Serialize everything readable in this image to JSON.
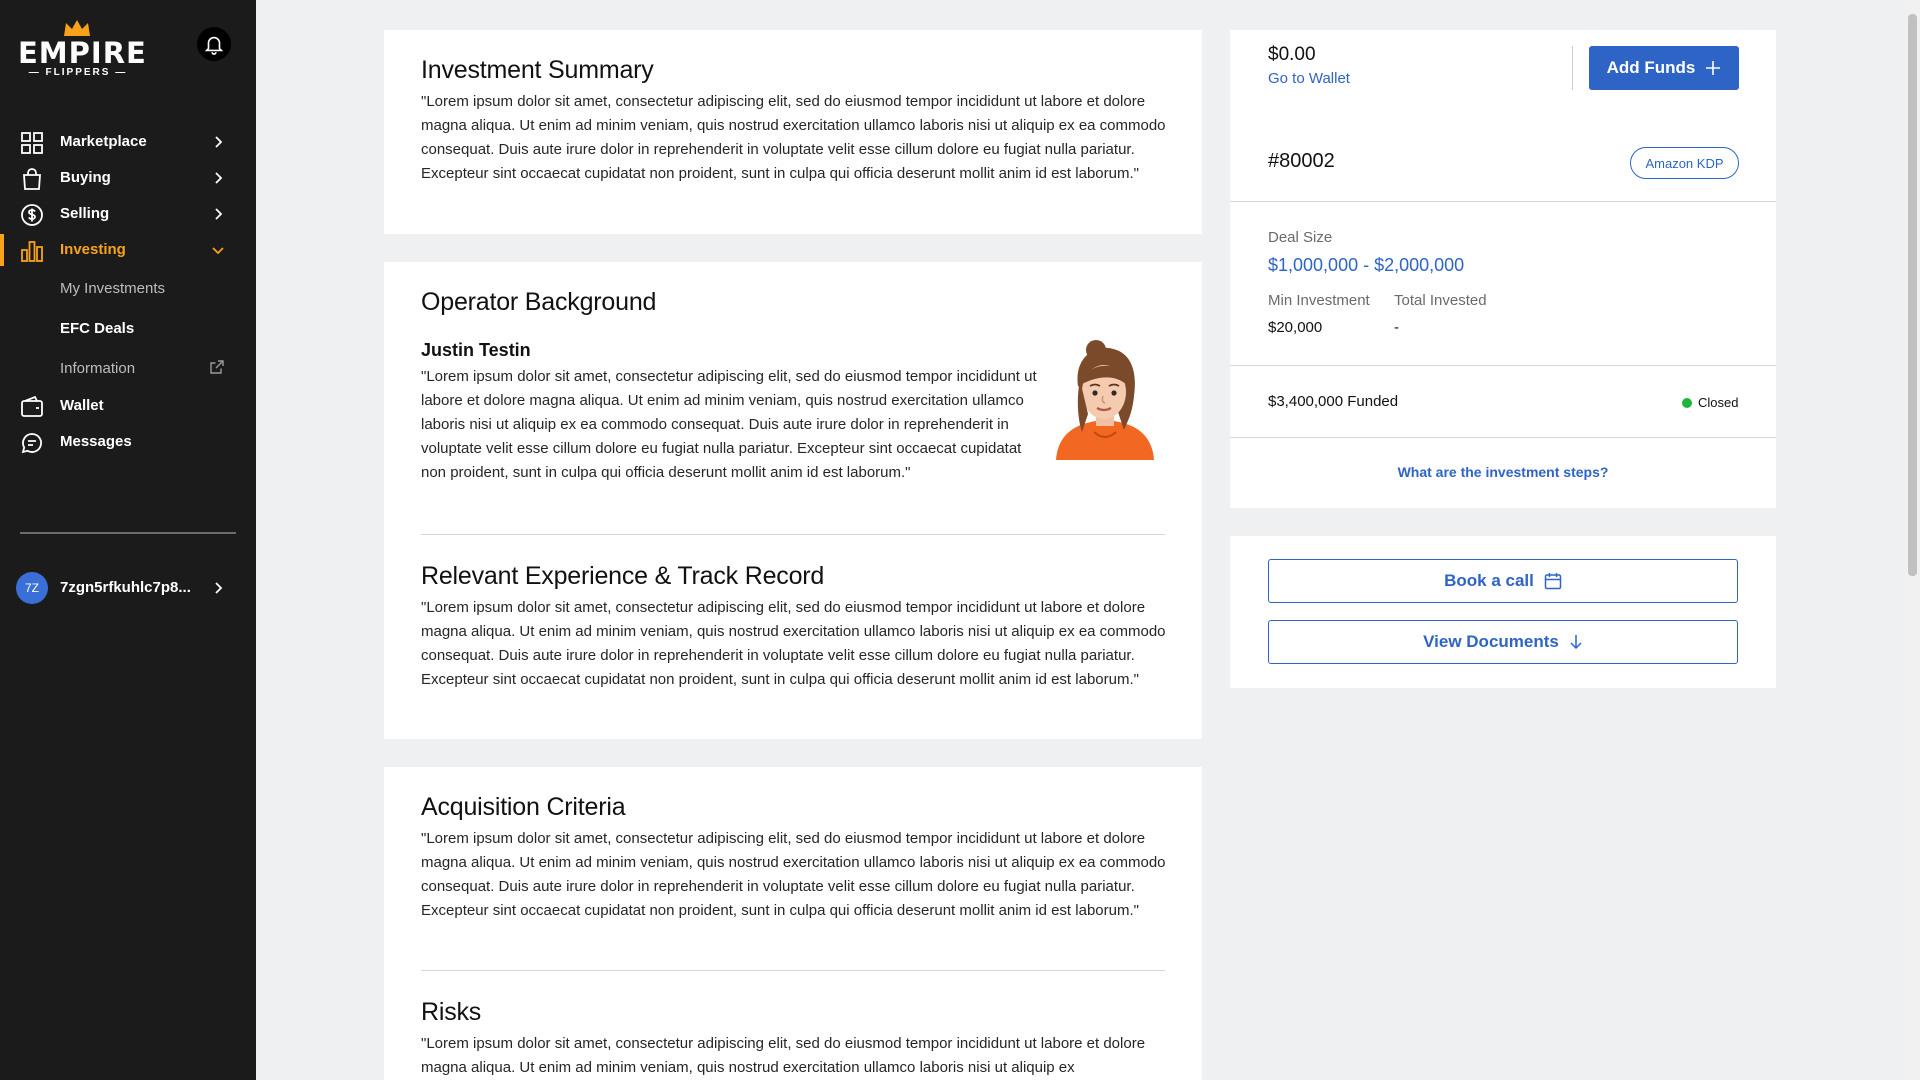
{
  "sidebar": {
    "logo": {
      "word": "EMPIRE",
      "sub": "— FLIPPERS —"
    },
    "items": [
      {
        "label": "Marketplace",
        "icon": "grid-icon"
      },
      {
        "label": "Buying",
        "icon": "shopping-bag-icon"
      },
      {
        "label": "Selling",
        "icon": "dollar-circle-icon"
      },
      {
        "label": "Investing",
        "icon": "bar-chart-icon"
      },
      {
        "label": "Wallet",
        "icon": "wallet-icon"
      },
      {
        "label": "Messages",
        "icon": "chat-icon"
      }
    ],
    "investing_sub": [
      {
        "label": "My Investments"
      },
      {
        "label": "EFC Deals"
      },
      {
        "label": "Information"
      }
    ],
    "user": {
      "initials": "7Z",
      "name": "7zgn5rfkuhlc7p8..."
    }
  },
  "main": {
    "investment_summary": {
      "title": "Investment Summary",
      "text": "\"Lorem ipsum dolor sit amet, consectetur adipiscing elit, sed do eiusmod tempor incididunt ut labore et dolore magna aliqua. Ut enim ad minim veniam, quis nostrud exercitation ullamco laboris nisi ut aliquip ex ea commodo consequat. Duis aute irure dolor in reprehenderit in voluptate velit esse cillum dolore eu fugiat nulla pariatur. Excepteur sint occaecat cupidatat non proident, sunt in culpa qui officia deserunt mollit anim id est laborum.\""
    },
    "operator_background": {
      "title": "Operator Background",
      "name": "Justin Testin",
      "text": "\"Lorem ipsum dolor sit amet, consectetur adipiscing elit, sed do eiusmod tempor incididunt ut labore et dolore magna aliqua. Ut enim ad minim veniam, quis nostrud exercitation ullamco laboris nisi ut aliquip ex ea commodo consequat. Duis aute irure dolor in reprehenderit in voluptate velit esse cillum dolore eu fugiat nulla pariatur. Excepteur sint occaecat cupidatat non proident, sunt in culpa qui officia deserunt mollit anim id est laborum.\""
    },
    "experience": {
      "title": "Relevant Experience & Track Record",
      "text": "\"Lorem ipsum dolor sit amet, consectetur adipiscing elit, sed do eiusmod tempor incididunt ut labore et dolore magna aliqua. Ut enim ad minim veniam, quis nostrud exercitation ullamco laboris nisi ut aliquip ex ea commodo consequat. Duis aute irure dolor in reprehenderit in voluptate velit esse cillum dolore eu fugiat nulla pariatur. Excepteur sint occaecat cupidatat non proident, sunt in culpa qui officia deserunt mollit anim id est laborum.\""
    },
    "acquisition": {
      "title": "Acquisition Criteria",
      "text": "\"Lorem ipsum dolor sit amet, consectetur adipiscing elit, sed do eiusmod tempor incididunt ut labore et dolore magna aliqua. Ut enim ad minim veniam, quis nostrud exercitation ullamco laboris nisi ut aliquip ex ea commodo consequat. Duis aute irure dolor in reprehenderit in voluptate velit esse cillum dolore eu fugiat nulla pariatur. Excepteur sint occaecat cupidatat non proident, sunt in culpa qui officia deserunt mollit anim id est laborum.\""
    },
    "risks": {
      "title": "Risks",
      "text": "\"Lorem ipsum dolor sit amet, consectetur adipiscing elit, sed do eiusmod tempor incididunt ut labore et dolore magna aliqua. Ut enim ad minim veniam, quis nostrud exercitation ullamco laboris nisi ut aliquip ex"
    }
  },
  "wallet": {
    "balance": "$0.00",
    "link": "Go to Wallet",
    "add_funds": "Add Funds"
  },
  "deal": {
    "id": "#80002",
    "tag": "Amazon KDP",
    "deal_size_label": "Deal Size",
    "deal_size": "$1,000,000 - $2,000,000",
    "min_investment_label": "Min Investment",
    "min_investment": "$20,000",
    "total_invested_label": "Total Invested",
    "total_invested": "-",
    "funded": "$3,400,000 Funded",
    "status": "Closed",
    "status_color": "#1fb53a",
    "steps_link": "What are the investment steps?"
  },
  "actions": {
    "book_call": "Book a call",
    "view_documents": "View Documents"
  },
  "colors": {
    "accent": "#f7a21b",
    "primary": "#2e64c6",
    "sidebar_bg": "#1b1b1b"
  }
}
